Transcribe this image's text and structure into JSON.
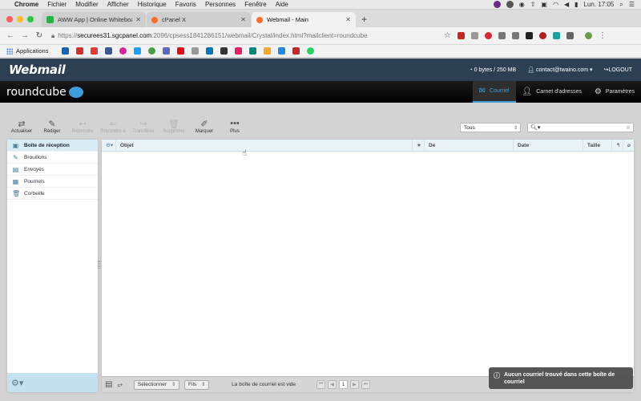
{
  "mac_menu": {
    "app": "Chrome",
    "items": [
      "Fichier",
      "Modifier",
      "Afficher",
      "Historique",
      "Favoris",
      "Personnes",
      "Fenêtre",
      "Aide"
    ],
    "clock": "Lun. 17:05"
  },
  "tabs": [
    {
      "title": "AWW App | Online Whiteboard"
    },
    {
      "title": "cPanel X"
    },
    {
      "title": "Webmail - Main"
    }
  ],
  "url": {
    "scheme": "https://",
    "host": "securees31.sgcpanel.com",
    "path": ":2096/cpsess1841286151/webmail/Crystal/index.html?mailclient=roundcube"
  },
  "bookmarks": {
    "apps_label": "Applications"
  },
  "webmail": {
    "logo": "Webmail",
    "quota": "0 bytes / 250 MB",
    "account": "contact@twaino.com",
    "logout": "LOGOUT"
  },
  "roundcube": {
    "logo_text": "roundcube",
    "nav": [
      {
        "label": "Courriel"
      },
      {
        "label": "Carnet d'adresses"
      },
      {
        "label": "Paramètres"
      }
    ]
  },
  "actions": [
    {
      "label": "Actualiser"
    },
    {
      "label": "Rédiger"
    },
    {
      "label": "Répondre"
    },
    {
      "label": "Répondre à"
    },
    {
      "label": "Transférer"
    },
    {
      "label": "Supprimer"
    },
    {
      "label": "Marquer"
    },
    {
      "label": "Plus"
    }
  ],
  "filter": {
    "value": "Tous"
  },
  "folders": [
    {
      "label": "Boîte de réception"
    },
    {
      "label": "Brouillons"
    },
    {
      "label": "Envoyés"
    },
    {
      "label": "Pourriels"
    },
    {
      "label": "Corbeille"
    }
  ],
  "columns": {
    "subject": "Objet",
    "from": "De",
    "date": "Date",
    "size": "Taille"
  },
  "footer": {
    "select": "Sélectionner",
    "threads": "Fils",
    "status": "La boîte de courriel est vide",
    "page": "1"
  },
  "toast": {
    "message": "Aucun courriel trouvé dans cette boîte de courriel"
  }
}
